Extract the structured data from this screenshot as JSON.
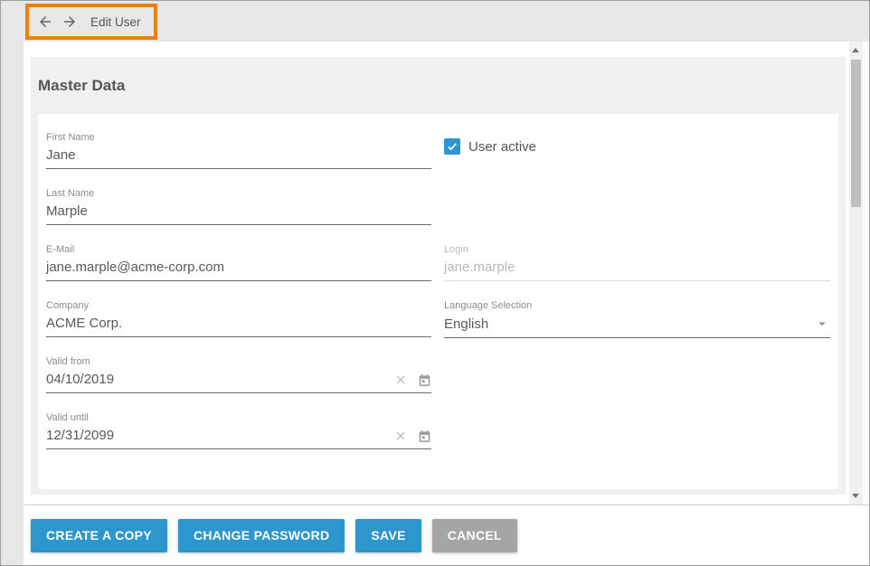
{
  "header": {
    "title": "Edit User"
  },
  "master_data": {
    "title": "Master Data"
  },
  "form": {
    "first_name": {
      "label": "First Name",
      "value": "Jane"
    },
    "last_name": {
      "label": "Last Name",
      "value": "Marple"
    },
    "email": {
      "label": "E-Mail",
      "value": "jane.marple@acme-corp.com"
    },
    "company": {
      "label": "Company",
      "value": "ACME Corp."
    },
    "valid_from": {
      "label": "Valid from",
      "value": "04/10/2019"
    },
    "valid_until": {
      "label": "Valid until",
      "value": "12/31/2099"
    },
    "user_active": {
      "label": "User active",
      "checked": true
    },
    "login": {
      "label": "Login",
      "value": "jane.marple",
      "disabled": true
    },
    "language": {
      "label": "Language Selection",
      "value": "English"
    }
  },
  "buttons": {
    "create_copy": "CREATE A COPY",
    "change_password": "CHANGE PASSWORD",
    "save": "SAVE",
    "cancel": "CANCEL"
  },
  "icons": {
    "back": "arrow-left-icon",
    "forward": "arrow-right-icon",
    "clear": "x-icon",
    "calendar": "calendar-icon",
    "dropdown": "caret-down-icon",
    "checkmark": "check-icon",
    "scroll_up": "triangle-up-icon",
    "scroll_down": "triangle-down-icon"
  },
  "colors": {
    "accent_blue": "#2d96cc",
    "highlight_orange": "#e8820e",
    "cancel_gray": "#a5a5a5"
  }
}
